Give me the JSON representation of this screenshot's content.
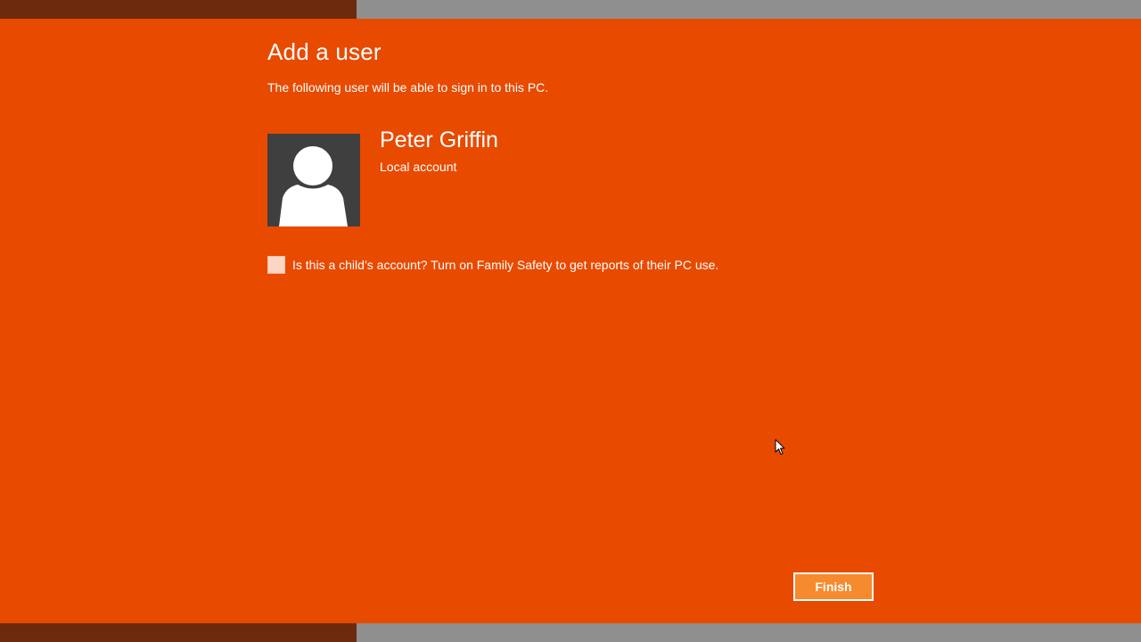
{
  "header": {
    "title": "Add a user",
    "subtitle": "The following user will be able to sign in to this PC."
  },
  "user": {
    "avatar_icon": "user-silhouette-icon",
    "name": "Peter Griffin",
    "account_type": "Local account"
  },
  "family_safety": {
    "label": "Is this a child’s account? Turn on Family Safety to get reports of their PC use.",
    "checked": false
  },
  "footer": {
    "finish_label": "Finish"
  },
  "colors": {
    "background": "#e84a00",
    "strip_dark": "#6d2a0c",
    "strip_grey": "#8f8f8f",
    "button_fill": "#f68a2e",
    "avatar_bg": "#3f3f3f"
  }
}
